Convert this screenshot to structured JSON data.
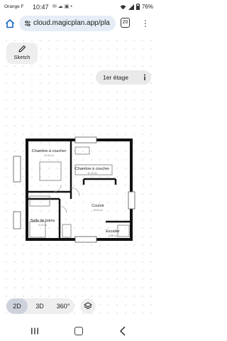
{
  "status_bar": {
    "carrier": "Orange F",
    "time": "10:47",
    "battery": "76%"
  },
  "browser": {
    "url": "cloud.magicplan.app/pla",
    "tab_count": "20"
  },
  "toolbar": {
    "sketch_label": "Sketch",
    "floor_label": "1er étage"
  },
  "floorplan": {
    "rooms": [
      {
        "name": "Chambre à coucher",
        "area": "13.93 m²"
      },
      {
        "name": "Chambre à coucher",
        "area": "11.18 m²"
      },
      {
        "name": "Couloir",
        "area": "15.52 m²"
      },
      {
        "name": "Salle de bains",
        "area": "5.34 m²"
      },
      {
        "name": "Escalier",
        "area": "3.68 m²"
      }
    ]
  },
  "view_modes": {
    "selected": "2D",
    "options": [
      "2D",
      "3D",
      "360°"
    ]
  },
  "icons": {
    "home": "home-icon",
    "site": "site-settings-icon",
    "menu": "more-vert-icon",
    "sketch": "sketch-pencil-icon",
    "info": "info-icon",
    "layers": "layers-icon"
  },
  "colors": {
    "url_pill": "#e6edf7",
    "active_view": "#cdd2dc",
    "wall": "#111111"
  }
}
